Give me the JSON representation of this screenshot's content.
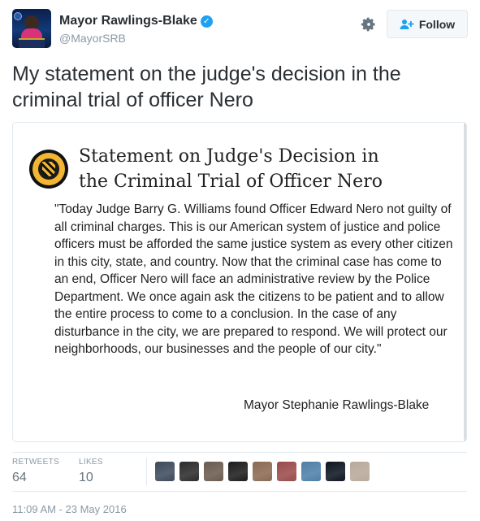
{
  "user": {
    "name": "Mayor Rawlings-Blake",
    "handle": "@MayorSRB",
    "verified_icon": "verified-badge-icon",
    "follow_label": "Follow"
  },
  "tweet": {
    "text": "My statement on the judge's decision in the criminal trial of officer Nero"
  },
  "card": {
    "title_line1": "Statement on Judge's Decision in",
    "title_line2": "the Criminal Trial of Officer Nero",
    "body": "\"Today Judge Barry G. Williams found Officer Edward Nero not guilty of all criminal charges. This is our American system of justice and police officers must be afforded the same justice system as every other citizen in this city, state, and country.  Now that the criminal case has come to an end, Officer Nero will face an administrative review by the Police Department. We once again ask the citizens to be patient and to allow the entire process to come to a conclusion. In the case of any disturbance in the city, we are prepared to respond.  We will protect our neighborhoods, our businesses and the people of our city.\"",
    "signature": "Mayor Stephanie Rawlings-Blake"
  },
  "stats": {
    "retweets_label": "RETWEETS",
    "retweets_value": "64",
    "likes_label": "LIKES",
    "likes_value": "10"
  },
  "likers": [
    {
      "color": "#3d4a5c"
    },
    {
      "color": "#2b2b2b"
    },
    {
      "color": "#6b5a4e"
    },
    {
      "color": "#1c1c1c"
    },
    {
      "color": "#8a6a52"
    },
    {
      "color": "#9a4a4a"
    },
    {
      "color": "#4f7ea8"
    },
    {
      "color": "#0e1520"
    },
    {
      "color": "#b8a99a"
    }
  ],
  "timestamp": "11:09 AM - 23 May 2016",
  "colors": {
    "accent": "#1da1f2",
    "muted": "#8899a6",
    "text": "#292f33"
  }
}
